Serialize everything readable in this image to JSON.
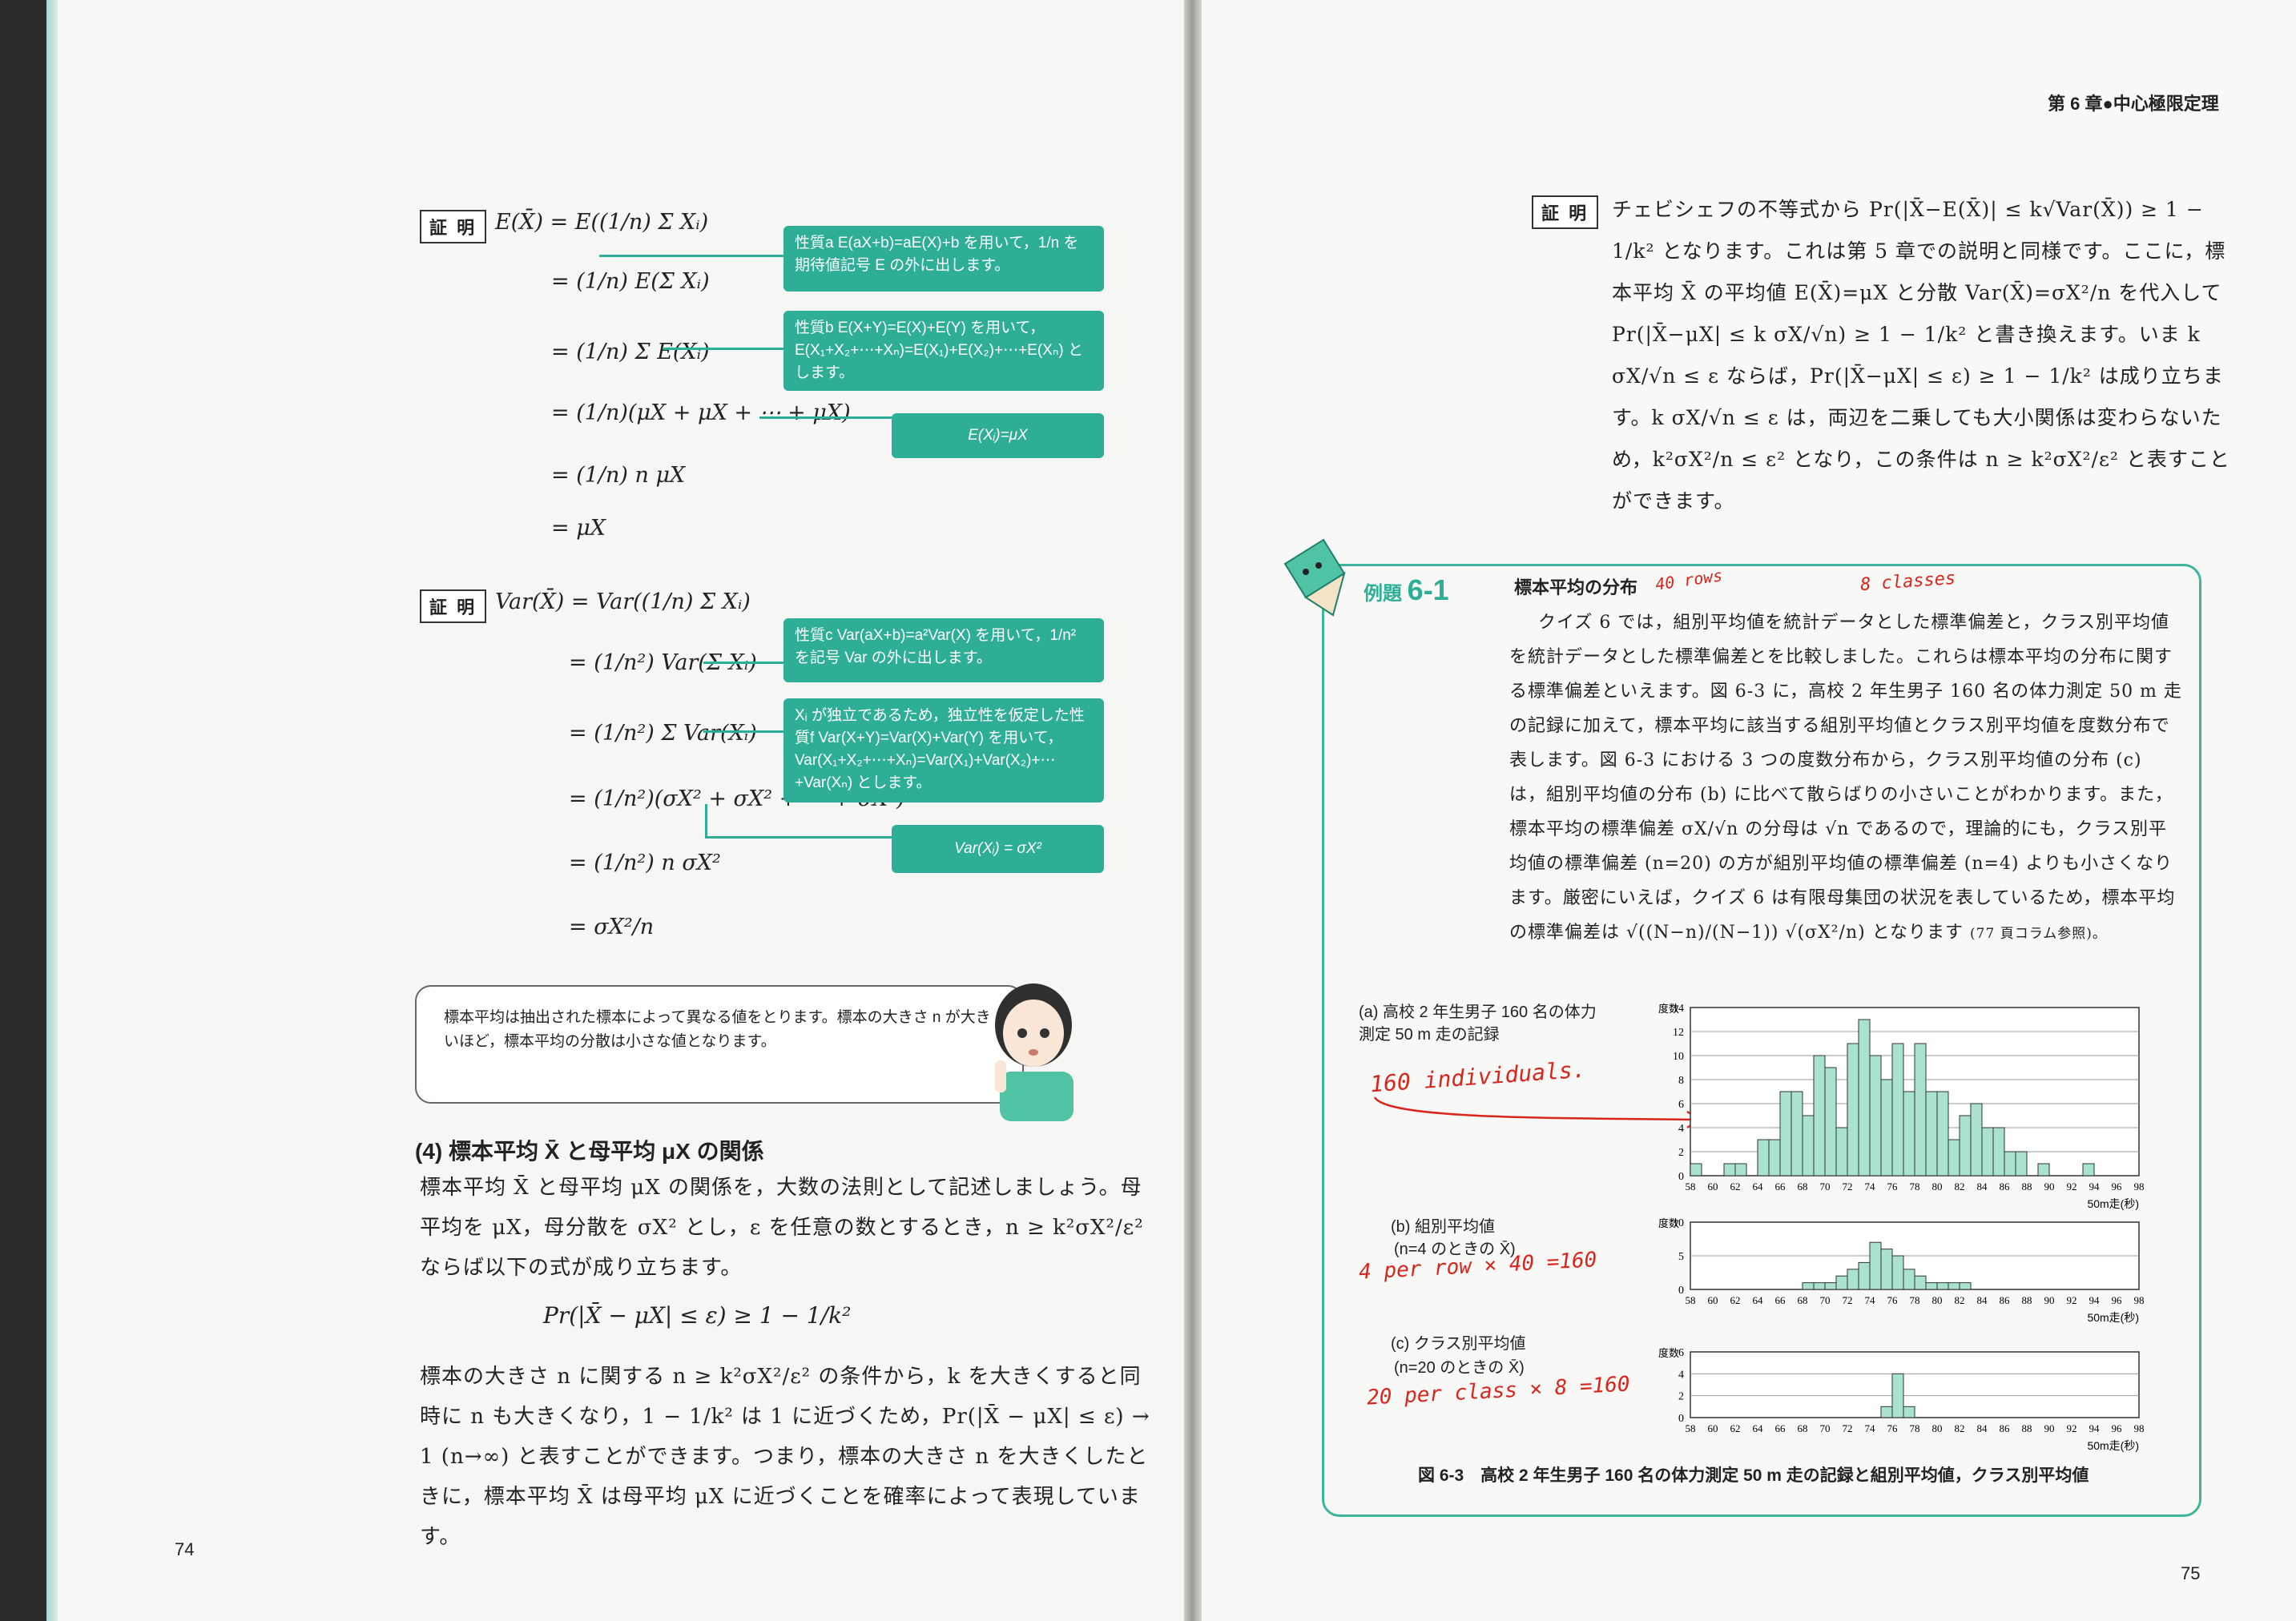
{
  "left_page": {
    "page_number": "74",
    "proof_label": "証 明",
    "proof1": {
      "lines": [
        "E(X̄) = E((1/n) Σ Xᵢ)",
        "= (1/n) E(Σ Xᵢ)",
        "= (1/n) Σ E(Xᵢ)",
        "= (1/n)(μX + μX + ⋯ + μX)",
        "= (1/n) n μX",
        "= μX"
      ],
      "notes": [
        "性質a E(aX+b)=aE(X)+b を用いて，1/n を期待値記号 E の外に出します。",
        "性質b E(X+Y)=E(X)+E(Y) を用いて，E(X₁+X₂+⋯+Xₙ)=E(X₁)+E(X₂)+⋯+E(Xₙ) とします。",
        "E(Xᵢ)=μX"
      ]
    },
    "proof2": {
      "lines": [
        "Var(X̄) = Var((1/n) Σ Xᵢ)",
        "= (1/n²) Var(Σ Xᵢ)",
        "= (1/n²) Σ Var(Xᵢ)",
        "= (1/n²)(σX² + σX² + ⋯ + σX²)",
        "= (1/n²) n σX²",
        "= σX²/n"
      ],
      "notes": [
        "性質c Var(aX+b)=a²Var(X) を用いて，1/n² を記号 Var の外に出します。",
        "Xᵢ が独立であるため，独立性を仮定した性質f Var(X+Y)=Var(X)+Var(Y) を用いて，Var(X₁+X₂+⋯+Xₙ)=Var(X₁)+Var(X₂)+⋯+Var(Xₙ) とします。",
        "Var(Xᵢ) = σX²"
      ]
    },
    "speech_bubble": "標本平均は抽出された標本によって異なる値をとります。標本の大きさ n が大きいほど，標本平均の分散は小さな値となります。",
    "section_heading": "(4) 標本平均 X̄ と母平均 μX の関係",
    "paragraph1": "標本平均 X̄ と母平均 μX の関係を，大数の法則として記述しましょう。母平均を μX，母分散を σX² とし，ε を任意の数とするとき，n ≥ k²σX²/ε² ならば以下の式が成り立ちます。",
    "formula": "Pr(|X̄ − μX| ≤ ε) ≥ 1 − 1/k²",
    "paragraph2": "標本の大きさ n に関する n ≥ k²σX²/ε² の条件から，k を大きくすると同時に n も大きくなり，1 − 1/k² は 1 に近づくため，Pr(|X̄ − μX| ≤ ε) → 1 (n→∞) と表すことができます。つまり，標本の大きさ n を大きくしたときに，標本平均 X̄ は母平均 μX に近づくことを確率によって表現しています。"
  },
  "right_page": {
    "page_number": "75",
    "chapter_header": "第 6 章●中心極限定理",
    "proof_label": "証 明",
    "proof_text": "チェビシェフの不等式から Pr(|X̄−E(X̄)| ≤ k√Var(X̄)) ≥ 1 − 1/k² となります。これは第 5 章での説明と同様です。ここに，標本平均 X̄ の平均値 E(X̄)=μX と分散 Var(X̄)=σX²/n を代入して Pr(|X̄−μX| ≤ k σX/√n) ≥ 1 − 1/k² と書き換えます。いま k σX/√n ≤ ε ならば，Pr(|X̄−μX| ≤ ε) ≥ 1 − 1/k² は成り立ちます。k σX/√n ≤ ε は，両辺を二乗しても大小関係は変わらないため，k²σX²/n ≤ ε² となり，この条件は n ≥ k²σX²/ε² と表すことができます。",
    "example": {
      "label": "例題",
      "number": "6-1",
      "title": "標本平均の分布",
      "text": "クイズ 6 では，組別平均値を統計データとした標準偏差と，クラス別平均値を統計データとした標準偏差とを比較しました。これらは標本平均の分布に関する標準偏差といえます。図 6-3 に，高校 2 年生男子 160 名の体力測定 50 m 走の記録に加えて，標本平均に該当する組別平均値とクラス別平均値を度数分布で表します。図 6-3 における 3 つの度数分布から，クラス別平均値の分布 (c) は，組別平均値の分布 (b) に比べて散らばりの小さいことがわかります。また，標本平均の標準偏差 σX/√n の分母は √n であるので，理論的にも，クラス別平均値の標準偏差 (n=20) の方が組別平均値の標準偏差 (n=4) よりも小さくなります。厳密にいえば，クイズ 6 は有限母集団の状況を表しているため，標本平均の標準偏差は √((N−n)/(N−1)) √(σX²/n) となります",
      "note_ref": "(77 頁コラム参照)。"
    },
    "handwriting": {
      "rows": "40 rows",
      "classes": "8 classes",
      "individuals": "160 individuals.",
      "per_row": "4 per row × 40 =160",
      "per_class": "20 per class × 8 =160"
    },
    "figure_caption": "図 6-3　高校 2 年生男子 160 名の体力測定 50 m 走の記録と組別平均値，クラス別平均値"
  },
  "chart_data": [
    {
      "type": "bar",
      "title": "(a) 高校 2 年生男子 160 名の体力測定 50 m 走の記録",
      "ylabel": "度数",
      "xlabel": "50m走(秒)",
      "ylim": [
        0,
        14
      ],
      "yticks": [
        0,
        2,
        4,
        6,
        8,
        10,
        12,
        14
      ],
      "xticks": [
        "58",
        "60",
        "62",
        "64",
        "66",
        "68",
        "70",
        "72",
        "74",
        "76",
        "78",
        "80",
        "82",
        "84",
        "86",
        "88",
        "90",
        "92",
        "94",
        "96",
        "98"
      ],
      "values": [
        1,
        0,
        0,
        1,
        1,
        0,
        3,
        3,
        7,
        7,
        5,
        10,
        9,
        4,
        11,
        13,
        10,
        8,
        11,
        7,
        11,
        7,
        7,
        3,
        5,
        6,
        4,
        4,
        2,
        2,
        0,
        1,
        0,
        0,
        0,
        1,
        0,
        0,
        0,
        0
      ],
      "color": "#a9e2cf"
    },
    {
      "type": "bar",
      "title": "(b) 組別平均値",
      "subtitle": "(n=4 のときの X̄)",
      "ylabel": "度数",
      "xlabel": "50m走(秒)",
      "ylim": [
        0,
        10
      ],
      "yticks": [
        0,
        5,
        10
      ],
      "xticks": [
        "58",
        "60",
        "62",
        "64",
        "66",
        "68",
        "70",
        "72",
        "74",
        "76",
        "78",
        "80",
        "82",
        "84",
        "86",
        "88",
        "90",
        "92",
        "94",
        "96",
        "98"
      ],
      "values": [
        0,
        0,
        0,
        0,
        0,
        0,
        0,
        0,
        0,
        0,
        1,
        1,
        1,
        2,
        3,
        4,
        7,
        6,
        5,
        3,
        2,
        1,
        1,
        1,
        1,
        0,
        0,
        0,
        0,
        0,
        0,
        0,
        0,
        0,
        0,
        0,
        0,
        0,
        0,
        0
      ],
      "color": "#a9e2cf"
    },
    {
      "type": "bar",
      "title": "(c) クラス別平均値",
      "subtitle": "(n=20 のときの X̄)",
      "ylabel": "度数",
      "xlabel": "50m走(秒)",
      "ylim": [
        0,
        6
      ],
      "yticks": [
        0,
        2,
        4,
        6
      ],
      "xticks": [
        "58",
        "60",
        "62",
        "64",
        "66",
        "68",
        "70",
        "72",
        "74",
        "76",
        "78",
        "80",
        "82",
        "84",
        "86",
        "88",
        "90",
        "92",
        "94",
        "96",
        "98"
      ],
      "values": [
        0,
        0,
        0,
        0,
        0,
        0,
        0,
        0,
        0,
        0,
        0,
        0,
        0,
        0,
        0,
        0,
        0,
        1,
        4,
        1,
        0,
        0,
        0,
        0,
        0,
        0,
        0,
        0,
        0,
        0,
        0,
        0,
        0,
        0,
        0,
        0,
        0,
        0,
        0,
        0
      ],
      "color": "#a9e2cf"
    }
  ]
}
